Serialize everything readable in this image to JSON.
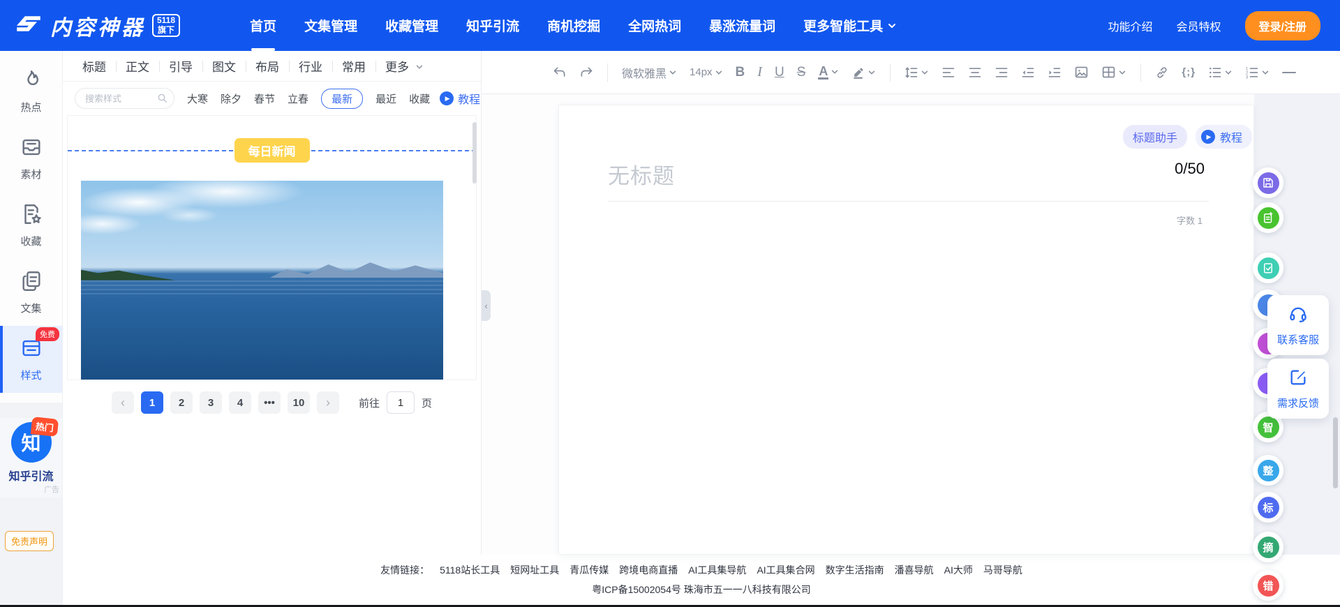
{
  "navbar": {
    "logo_text": "内容神器",
    "logo_badge": {
      "line1": "5118",
      "line2": "旗下"
    },
    "items": [
      "首页",
      "文集管理",
      "收藏管理",
      "知乎引流",
      "商机挖掘",
      "全网热词",
      "暴涨流量词",
      "更多智能工具"
    ],
    "active_item": "首页",
    "right_links": [
      "功能介绍",
      "会员特权"
    ],
    "login_button": "登录/注册"
  },
  "sidebar": {
    "items": [
      {
        "label": "热点"
      },
      {
        "label": "素材"
      },
      {
        "label": "收藏"
      },
      {
        "label": "文集"
      },
      {
        "label": "样式",
        "badge": "免费"
      }
    ],
    "active_item": "样式",
    "ad": {
      "char": "知",
      "badge": "热门",
      "label": "知乎引流",
      "watermark": "广告"
    },
    "disclaimer": "免责声明"
  },
  "panel": {
    "tabs": [
      "标题",
      "正文",
      "引导",
      "图文",
      "布局",
      "行业",
      "常用"
    ],
    "more_tab": "更多",
    "search": {
      "placeholder": "搜索样式"
    },
    "chips": [
      "大寒",
      "除夕",
      "春节",
      "立春",
      "最新",
      "最近",
      "收藏"
    ],
    "active_chip": "最新",
    "tutorial": "教程",
    "preview": {
      "badge": "每日新闻"
    },
    "pagination": {
      "prev": "‹",
      "pages": [
        "1",
        "2",
        "3",
        "4",
        "•••",
        "10"
      ],
      "active_page": "1",
      "next": "›",
      "goto_label": "前往",
      "goto_value": "1",
      "unit_label": "页"
    }
  },
  "editor": {
    "toolbar": {
      "font_family": "微软雅黑",
      "font_size": "14px",
      "bold": "B",
      "italic": "I",
      "underline": "U",
      "strike": "S",
      "font_color": "A",
      "code": "{;}"
    },
    "title_helper": "标题助手",
    "tutorial": "教程",
    "title_placeholder": "无标题",
    "char_counter": "0/50",
    "word_count_label": "字数",
    "word_count_value": "1"
  },
  "floating": {
    "cards": [
      {
        "label": "联系客服"
      },
      {
        "label": "需求反馈"
      }
    ],
    "icon_buttons": [
      {
        "name": "save",
        "color": "#7b6be6"
      },
      {
        "name": "new-doc",
        "color": "#49c32f"
      },
      {
        "name": "edit-doc",
        "color": "#3ecfb4"
      },
      {
        "name": "tool-blue",
        "color": "#4a87e8"
      },
      {
        "name": "tool-magenta",
        "color": "#c14fd6"
      },
      {
        "name": "tool-purple",
        "color": "#8b5cf6"
      }
    ],
    "char_buttons": [
      {
        "label": "智",
        "color": "#44c13c"
      },
      {
        "label": "整",
        "color": "#38a7ea"
      },
      {
        "label": "标",
        "color": "#4f6bf0"
      },
      {
        "label": "摘",
        "color": "#34a873"
      },
      {
        "label": "错",
        "color": "#f25555"
      }
    ]
  },
  "footer": {
    "links_label": "友情链接：",
    "links": [
      "5118站长工具",
      "短网址工具",
      "青瓜传媒",
      "跨境电商直播",
      "AI工具集导航",
      "AI工具集合网",
      "数字生活指南",
      "潘喜导航",
      "AI大师",
      "马哥导航"
    ],
    "icp": "粤ICP备15002054号 珠海市五一一八科技有限公司"
  },
  "colors": {
    "navbar_blue": "#1157ef",
    "accent_blue": "#2a6af2",
    "login_orange": "#ff8f1f",
    "badge_yellow": "#ffd44d",
    "free_badge_red": "#f5333f",
    "hot_badge_red": "#ff4f2e"
  }
}
